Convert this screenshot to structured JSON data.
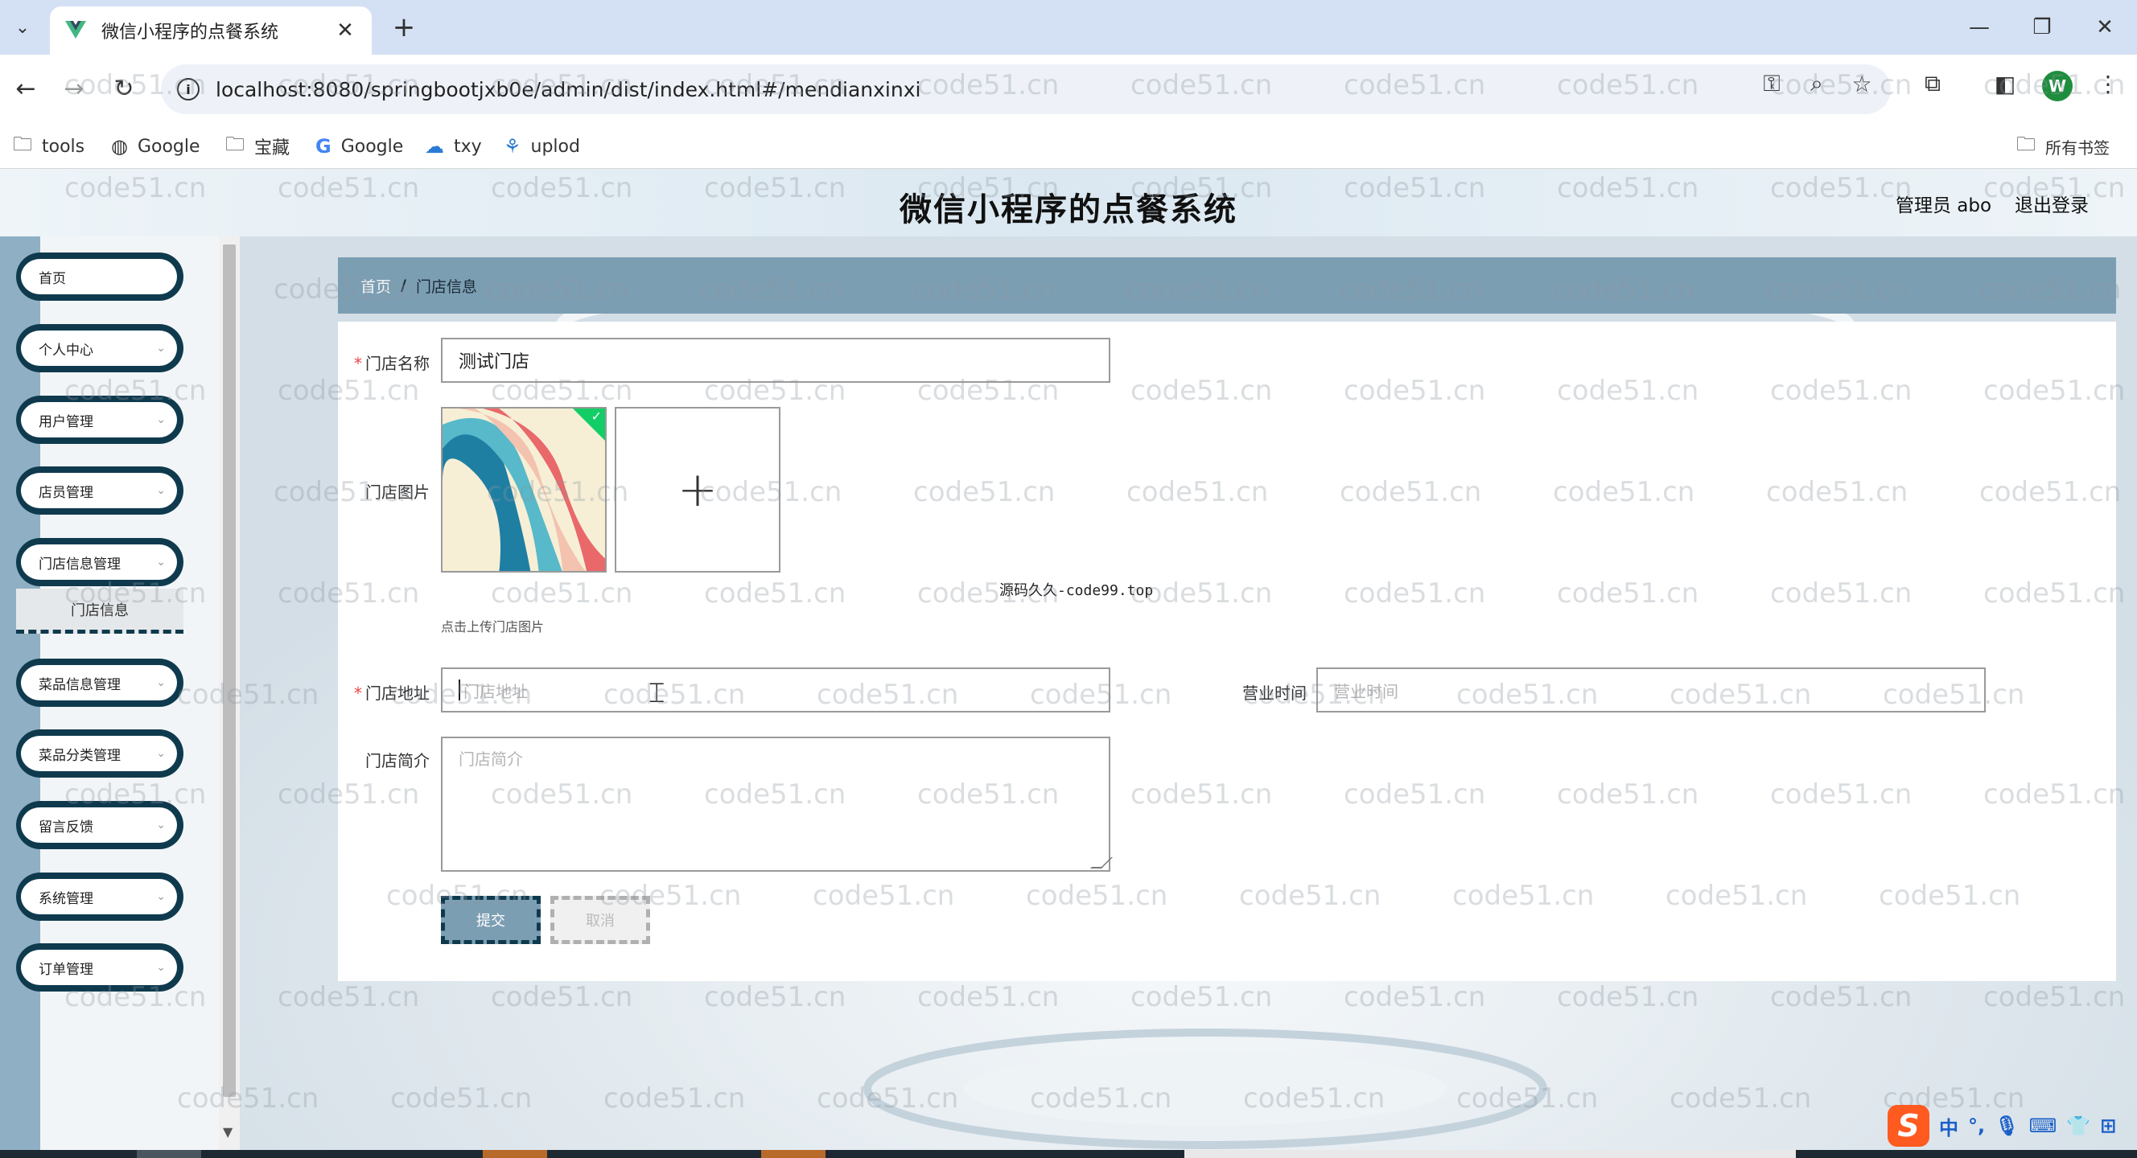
{
  "browser": {
    "tab_title": "微信小程序的点餐系统",
    "url": "localhost:8080/springbootjxb0e/admin/dist/index.html#/mendianxinxi",
    "profile_initial": "W",
    "bookmarks": [
      {
        "label": "tools",
        "icon": "folder-icon"
      },
      {
        "label": "Google",
        "icon": "globe-icon"
      },
      {
        "label": "宝藏",
        "icon": "folder-icon"
      },
      {
        "label": "Google",
        "icon": "google-icon"
      },
      {
        "label": "txy",
        "icon": "cloud-icon"
      },
      {
        "label": "uplod",
        "icon": "app-icon"
      }
    ],
    "all_bookmarks": "所有书签"
  },
  "header": {
    "title": "微信小程序的点餐系统",
    "user": "管理员 abo",
    "logout": "退出登录"
  },
  "sidebar": {
    "items": [
      {
        "label": "首页",
        "has_chevron": false
      },
      {
        "label": "个人中心",
        "has_chevron": true
      },
      {
        "label": "用户管理",
        "has_chevron": true
      },
      {
        "label": "店员管理",
        "has_chevron": true
      },
      {
        "label": "门店信息管理",
        "has_chevron": true
      },
      {
        "label": "菜品信息管理",
        "has_chevron": true
      },
      {
        "label": "菜品分类管理",
        "has_chevron": true
      },
      {
        "label": "留言反馈",
        "has_chevron": true
      },
      {
        "label": "系统管理",
        "has_chevron": true
      },
      {
        "label": "订单管理",
        "has_chevron": true
      }
    ],
    "submenu_active": "门店信息"
  },
  "breadcrumb": {
    "home": "首页",
    "separator": "/",
    "current": "门店信息"
  },
  "form": {
    "name_label": "门店名称",
    "name_value": "测试门店",
    "image_label": "门店图片",
    "upload_hint": "点击上传门店图片",
    "address_label": "门店地址",
    "address_placeholder": "门店地址",
    "hours_label": "营业时间",
    "hours_placeholder": "营业时间",
    "intro_label": "门店简介",
    "intro_placeholder": "门店简介",
    "submit_label": "提交",
    "cancel_label": "取消",
    "required_mark": "*"
  },
  "overlay_note": "源码久久-code99.top",
  "watermark_text": "code51.cn",
  "ime": {
    "lang": "中",
    "punct": "°,"
  },
  "colors": {
    "accent": "#7c9eb3",
    "menu_border": "#0f3a4e",
    "upload_ok": "#13ce66"
  }
}
